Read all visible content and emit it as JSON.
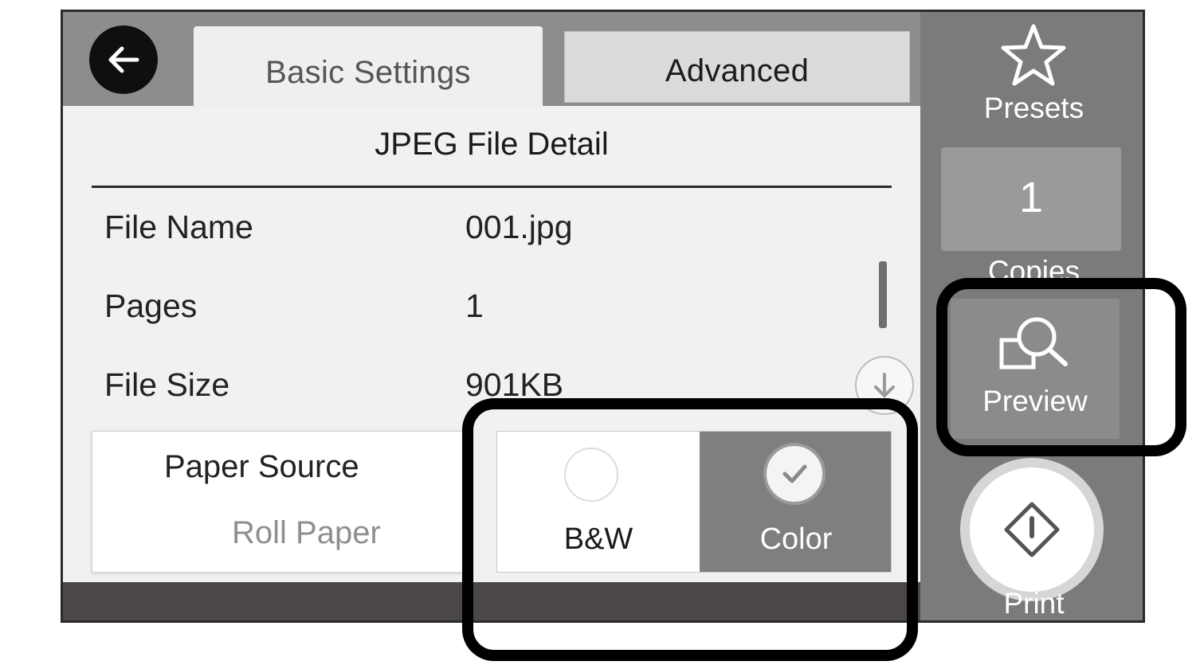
{
  "tabs": {
    "basic": "Basic Settings",
    "advanced": "Advanced"
  },
  "section_title": "JPEG File Detail",
  "details": [
    {
      "label": "File Name",
      "value": "001.jpg"
    },
    {
      "label": "Pages",
      "value": "1"
    },
    {
      "label": "File Size",
      "value": "901KB"
    }
  ],
  "paper_source": {
    "label": "Paper Source",
    "value": "Roll Paper"
  },
  "color_mode": {
    "options": [
      "B&W",
      "Color"
    ],
    "selected": "Color"
  },
  "side_panel": {
    "presets_label": "Presets",
    "copies_value": "1",
    "copies_label": "Copies",
    "preview_label": "Preview",
    "print_label": "Print"
  },
  "icons": {
    "back": "back-arrow-icon",
    "presets": "star-icon",
    "preview": "magnifier-icon",
    "print": "diamond-start-icon",
    "scroll": "down-arrow-icon",
    "selected": "check-icon"
  }
}
